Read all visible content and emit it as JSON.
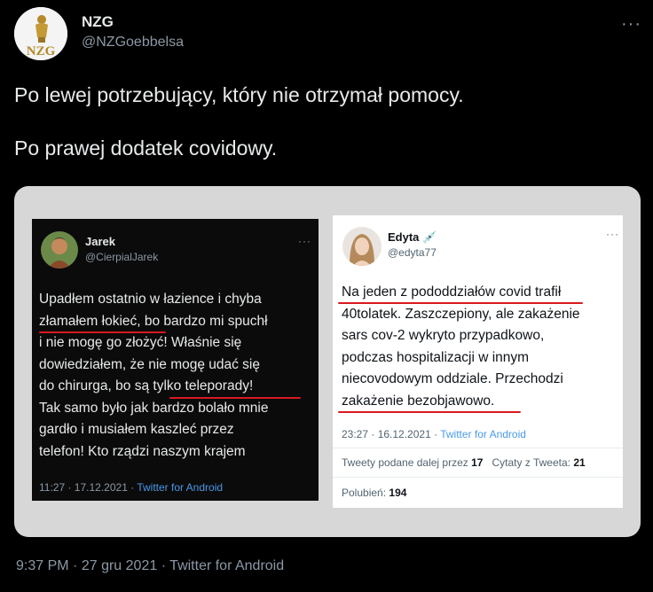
{
  "tweet": {
    "author": {
      "name": "NZG",
      "handle": "@NZGoebbelsa",
      "avatar_text": "NZG"
    },
    "more_icon": "more-dots-icon",
    "text": "Po lewej potrzebujący, który nie otrzymał pomocy.\n\nPo prawej dodatek covidowy.",
    "time": "9:37 PM",
    "date": "27 gru 2021",
    "source": "Twitter for Android",
    "separator": "·"
  },
  "left_screenshot": {
    "name": "Jarek",
    "handle": "@CierpialJarek",
    "body": "Upadłem ostatnio w łazience i chyba\nzłamałem łokieć, bo bardzo mi spuchł\ni nie mogę go złożyć! Właśnie się\ndowiedziałem, że nie mogę udać się\ndo chirurga, bo są tylko teleporady!\nTak samo było jak bardzo bolało mnie\ngardło i musiałem kaszleć przez\ntelefon! Kto rządzi naszym krajem",
    "timestamp": "11:27 · 17.12.2021 ·",
    "source": "Twitter for Android"
  },
  "right_screenshot": {
    "name": "Edyta",
    "name_emoji": "💉",
    "handle": "@edyta77",
    "body": "Na jeden z pododdziałów covid trafił\n40tolatek. Zaszczepiony, ale zakażenie\nsars cov-2 wykryto przypadkowo,\npodczas hospitalizacji w innym\nniecovodowym oddziale. Przechodzi\nzakażenie bezobjawowo.",
    "timestamp": "23:27 · 16.12.2021 ·",
    "source": "Twitter for Android",
    "retweets_label": "Tweety podane dalej przez",
    "retweets_value": "17",
    "quotes_label": "Cytaty z Tweeta:",
    "quotes_value": "21",
    "likes_label": "Polubień:",
    "likes_value": "194"
  },
  "colors": {
    "background": "#000000",
    "link": "#4a99e9",
    "underline": "#d81920"
  }
}
